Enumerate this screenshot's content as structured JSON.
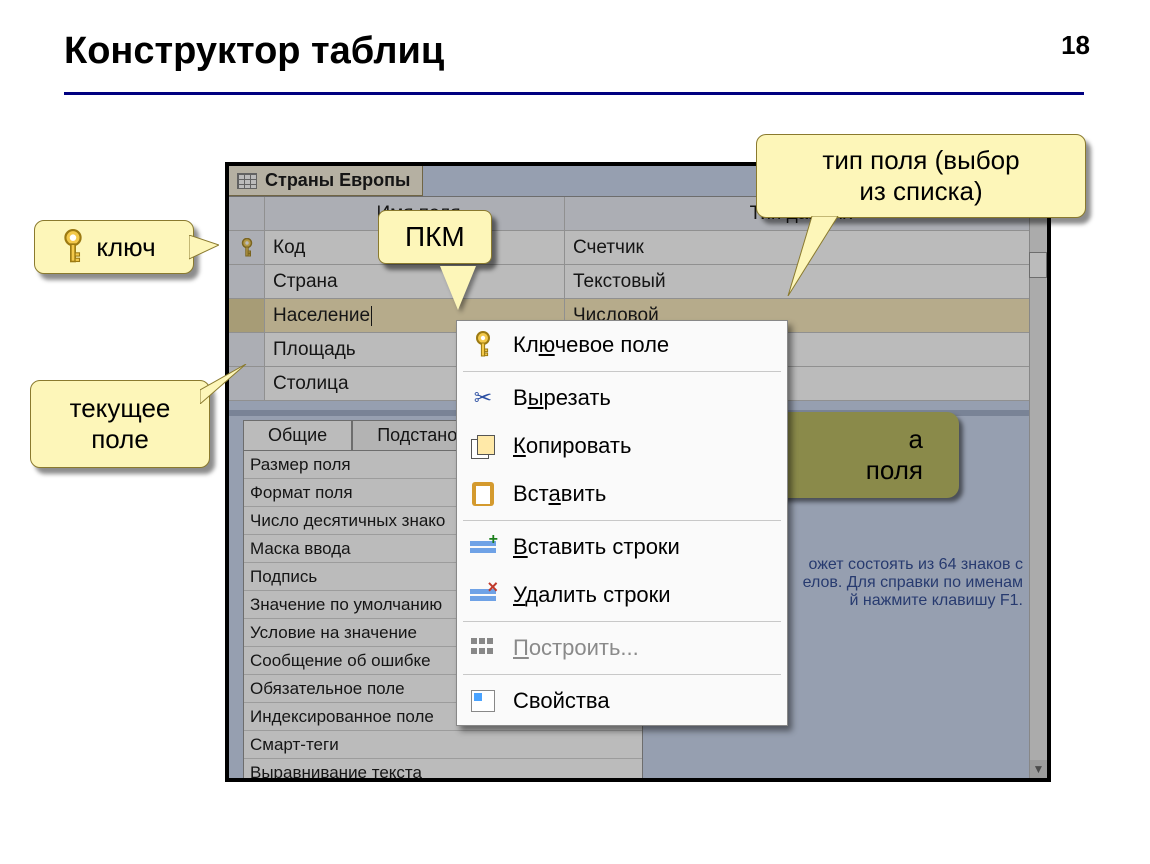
{
  "slide": {
    "title": "Конструктор таблиц",
    "page_number": "18"
  },
  "callouts": {
    "key": "ключ",
    "current_field": "текущее\nполе",
    "field_type": "тип поля (выбор\nиз списка)",
    "pkm": "ПКМ",
    "properties_hint_line1": "а",
    "properties_hint_line2": "поля"
  },
  "shot": {
    "tab_title": "Страны Европы",
    "grid_headers": {
      "name": "Имя поля",
      "type": "Тип данных"
    },
    "rows": [
      {
        "key": true,
        "name": "Код",
        "type": "Счетчик",
        "selected": false
      },
      {
        "key": false,
        "name": "Страна",
        "type": "Текстовый",
        "selected": false
      },
      {
        "key": false,
        "name": "Население",
        "type": "Числовой",
        "selected": true
      },
      {
        "key": false,
        "name": "Площадь",
        "type": "",
        "selected": false
      },
      {
        "key": false,
        "name": "Столица",
        "type": "",
        "selected": false
      }
    ],
    "prop_tabs": {
      "general": "Общие",
      "lookup": "Подстанов"
    },
    "properties": [
      "Размер поля",
      "Формат поля",
      "Число десятичных знако",
      "Маска ввода",
      "Подпись",
      "Значение по умолчанию",
      "Условие на значение",
      "Сообщение об ошибке",
      "Обязательное поле",
      "Индексированное поле",
      "Смарт-теги",
      "Выравнивание текста"
    ],
    "help_text": "ожет состоять из 64 знаков с\nелов.  Для справки по именам\nй нажмите клавишу F1."
  },
  "context_menu": {
    "items": [
      {
        "id": "key-field",
        "icon": "key-icon",
        "label": "Ключевое поле",
        "underline_index": 2
      },
      {
        "sep": true
      },
      {
        "id": "cut",
        "icon": "scissor-icon",
        "label": "Вырезать",
        "underline_index": 1
      },
      {
        "id": "copy",
        "icon": "copy-icon",
        "label": "Копировать",
        "underline_index": 0
      },
      {
        "id": "paste",
        "icon": "paste-icon",
        "label": "Вставить",
        "underline_index": 3
      },
      {
        "sep": true
      },
      {
        "id": "insert-rows",
        "icon": "insert-row-icon",
        "label": "Вставить строки",
        "underline_index": 0
      },
      {
        "id": "delete-rows",
        "icon": "delete-row-icon",
        "label": "Удалить строки",
        "underline_index": 0
      },
      {
        "sep": true
      },
      {
        "id": "build",
        "icon": "builder-icon",
        "label": "Построить...",
        "underline_index": 0,
        "disabled": true
      },
      {
        "sep": true
      },
      {
        "id": "properties",
        "icon": "props-icon",
        "label": "Свойства",
        "underline_index": -1
      }
    ]
  }
}
